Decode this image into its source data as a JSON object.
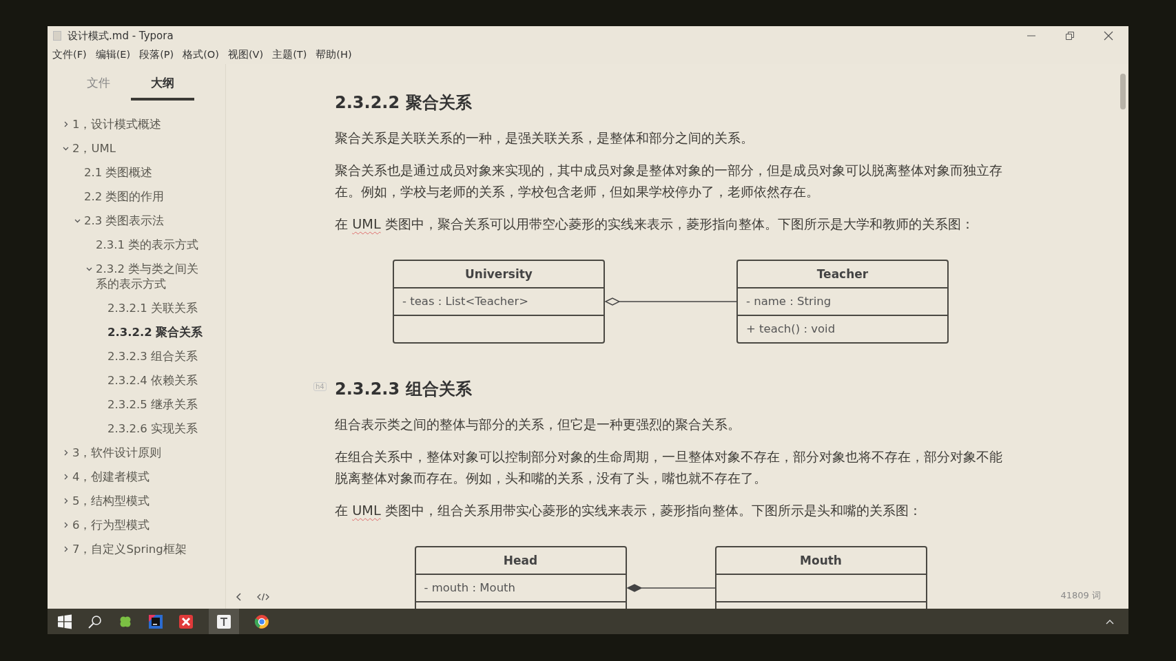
{
  "window": {
    "title": "设计模式.md - Typora"
  },
  "menu": [
    "文件(F)",
    "编辑(E)",
    "段落(P)",
    "格式(O)",
    "视图(V)",
    "主题(T)",
    "帮助(H)"
  ],
  "sidebar_tabs": [
    {
      "label": "文件",
      "selected": false
    },
    {
      "label": "大纲",
      "selected": true
    }
  ],
  "outline": [
    {
      "label": "1，设计模式概述",
      "expanded": false,
      "selected": false
    },
    {
      "label": "2，UML",
      "expanded": true,
      "selected": false,
      "children": [
        {
          "label": "2.1 类图概述",
          "selected": false
        },
        {
          "label": "2.2 类图的作用",
          "selected": false
        },
        {
          "label": "2.3 类图表示法",
          "expanded": true,
          "selected": false,
          "children": [
            {
              "label": "2.3.1 类的表示方式",
              "selected": false
            },
            {
              "label": "2.3.2 类与类之间关系的表示方式",
              "expanded": true,
              "selected": false,
              "children": [
                {
                  "label": "2.3.2.1 关联关系",
                  "selected": false
                },
                {
                  "label": "2.3.2.2 聚合关系",
                  "selected": true
                },
                {
                  "label": "2.3.2.3 组合关系",
                  "selected": false
                },
                {
                  "label": "2.3.2.4 依赖关系",
                  "selected": false
                },
                {
                  "label": "2.3.2.5 继承关系",
                  "selected": false
                },
                {
                  "label": "2.3.2.6 实现关系",
                  "selected": false
                }
              ]
            }
          ]
        }
      ]
    },
    {
      "label": "3，软件设计原则",
      "expanded": false,
      "selected": false
    },
    {
      "label": "4，创建者模式",
      "expanded": false,
      "selected": false
    },
    {
      "label": "5，结构型模式",
      "expanded": false,
      "selected": false
    },
    {
      "label": "6，行为型模式",
      "expanded": false,
      "selected": false
    },
    {
      "label": "7，自定义Spring框架",
      "expanded": false,
      "selected": false
    }
  ],
  "document": [
    {
      "kind": "heading",
      "text": "2.3.2.2 聚合关系"
    },
    {
      "kind": "paragraph",
      "text": "聚合关系是关联关系的一种，是强关联关系，是整体和部分之间的关系。"
    },
    {
      "kind": "paragraph",
      "text": "聚合关系也是通过成员对象来实现的，其中成员对象是整体对象的一部分，但是成员对象可以脱离整体对象而独立存在。例如，学校与老师的关系，学校包含老师，但如果学校停办了，老师依然存在。"
    },
    {
      "kind": "uml_paragraph",
      "before": "在 ",
      "term": "UML",
      "after": " 类图中，聚合关系可以用带空心菱形的实线来表示，菱形指向整体。下图所示是大学和教师的关系图："
    },
    {
      "kind": "aggregation_diagram",
      "left": {
        "name": "University",
        "attributes": [
          "- teas : List<Teacher>"
        ]
      },
      "right": {
        "name": "Teacher",
        "attributes": [
          "- name : String"
        ],
        "methods": [
          "+ teach() : void"
        ]
      }
    },
    {
      "kind": "heading",
      "text": "2.3.2.3 组合关系",
      "badge": "h4"
    },
    {
      "kind": "paragraph",
      "text": "组合表示类之间的整体与部分的关系，但它是一种更强烈的聚合关系。"
    },
    {
      "kind": "paragraph",
      "text": "在组合关系中，整体对象可以控制部分对象的生命周期，一旦整体对象不存在，部分对象也将不存在，部分对象不能脱离整体对象而存在。例如，头和嘴的关系，没有了头，嘴也就不存在了。"
    },
    {
      "kind": "uml_paragraph",
      "before": "在 ",
      "term": "UML",
      "after": " 类图中，组合关系用带实心菱形的实线来表示，菱形指向整体。下图所示是头和嘴的关系图："
    },
    {
      "kind": "composition_diagram",
      "left": {
        "name": "Head",
        "attributes": [
          "- mouth : Mouth"
        ]
      },
      "right": {
        "name": "Mouth"
      }
    }
  ],
  "footer": {
    "word_count": "41809 词"
  }
}
